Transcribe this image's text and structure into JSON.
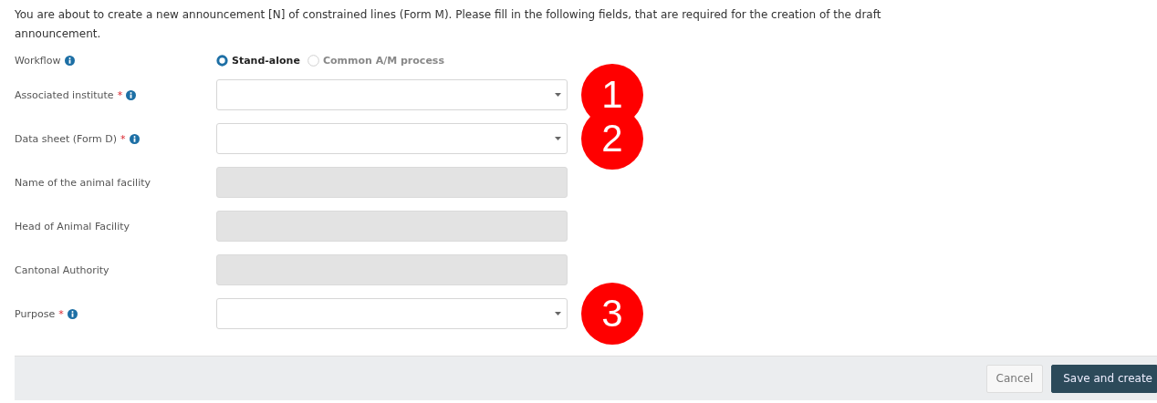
{
  "intro": "You are about to create a new announcement [N] of constrained lines (Form M). Please fill in the following fields, that are required for the creation of the draft announcement.",
  "workflow": {
    "label": "Workflow",
    "info": true,
    "options": [
      {
        "label": "Stand-alone",
        "selected": true
      },
      {
        "label": "Common A/M process",
        "selected": false
      }
    ]
  },
  "fields": [
    {
      "label": "Associated institute",
      "required_mark": "*",
      "info": true,
      "kind": "select",
      "marker": "1"
    },
    {
      "label": "Data sheet (Form D)",
      "required_mark": "*",
      "info": true,
      "kind": "select",
      "marker": "2"
    },
    {
      "label": "Name of the animal facility",
      "info": false,
      "kind": "readonly"
    },
    {
      "label": "Head of Animal Facility",
      "info": false,
      "kind": "readonly"
    },
    {
      "label": "Cantonal Authority",
      "info": false,
      "kind": "readonly"
    },
    {
      "label": "Purpose",
      "required_mark": "*",
      "info": true,
      "kind": "select",
      "marker": "3"
    }
  ],
  "buttons": [
    {
      "label": "Cancel",
      "kind": "secondary"
    },
    {
      "label": "Save and create",
      "kind": "primary"
    }
  ]
}
